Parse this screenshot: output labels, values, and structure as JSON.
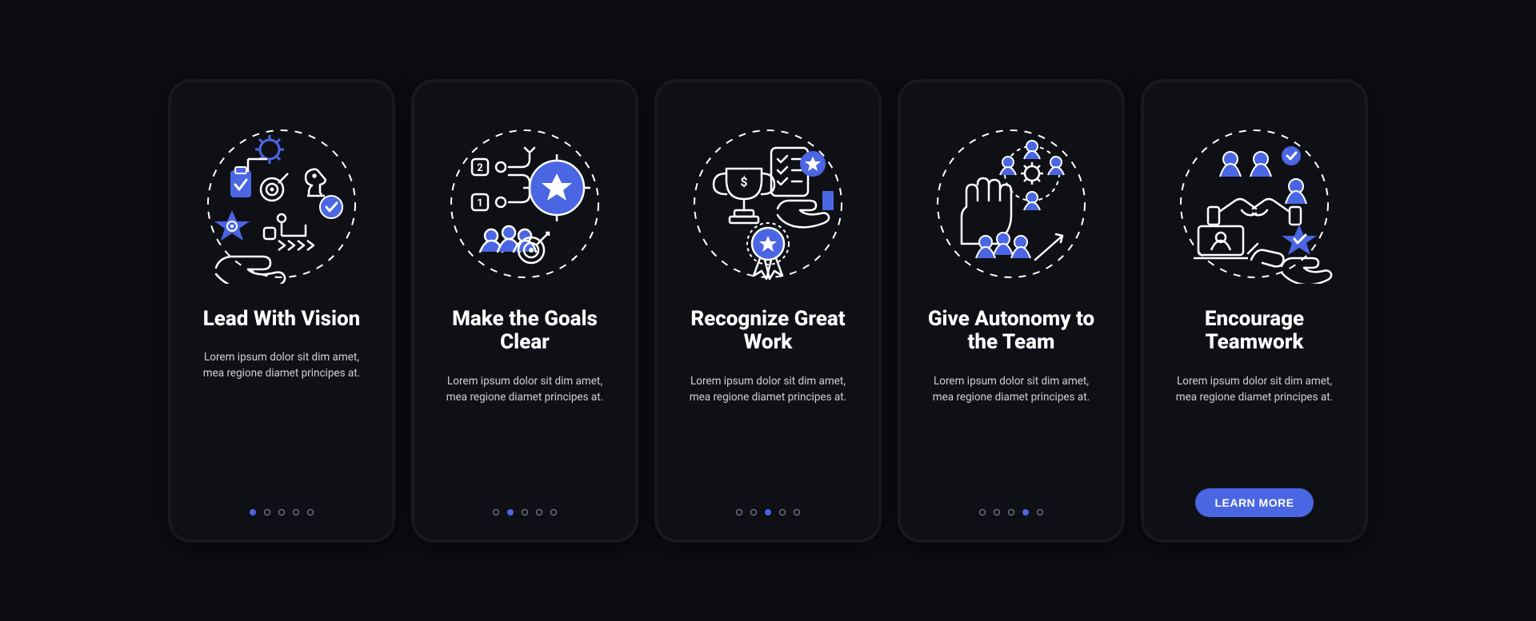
{
  "palette": {
    "accent": "#4b66e3",
    "card_bg": "#0f1016",
    "page_bg": "#0c0d12",
    "text": "#ffffff",
    "muted": "#cfd0d6",
    "dot_outline": "#8f93a3"
  },
  "screens": [
    {
      "icon": "vision-icon",
      "title": "Lead With Vision",
      "body": "Lorem ipsum dolor sit dim amet, mea regione diamet principes at.",
      "total_dots": 5,
      "active_dot": 0,
      "has_cta": false
    },
    {
      "icon": "goals-icon",
      "title": "Make the Goals Clear",
      "body": "Lorem ipsum dolor sit dim amet, mea regione diamet principes at.",
      "total_dots": 5,
      "active_dot": 1,
      "has_cta": false
    },
    {
      "icon": "recognize-icon",
      "title": "Recognize Great Work",
      "body": "Lorem ipsum dolor sit dim amet, mea regione diamet principes at.",
      "total_dots": 5,
      "active_dot": 2,
      "has_cta": false
    },
    {
      "icon": "autonomy-icon",
      "title": "Give Autonomy to the Team",
      "body": "Lorem ipsum dolor sit dim amet, mea regione diamet principes at.",
      "total_dots": 5,
      "active_dot": 3,
      "has_cta": false
    },
    {
      "icon": "teamwork-icon",
      "title": "Encourage Teamwork",
      "body": "Lorem ipsum dolor sit dim amet, mea regione diamet principes at.",
      "total_dots": 5,
      "active_dot": 4,
      "has_cta": true,
      "cta_label": "LEARN MORE"
    }
  ]
}
